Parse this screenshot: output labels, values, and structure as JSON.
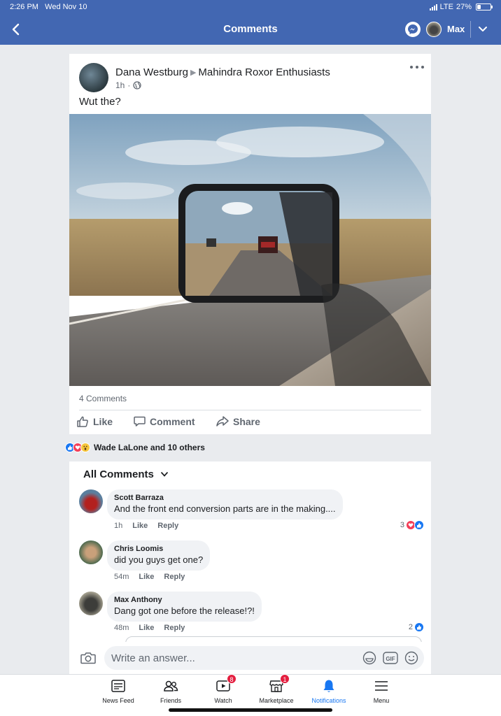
{
  "status_bar": {
    "time": "2:26 PM",
    "date": "Wed Nov 10",
    "network": "LTE",
    "battery": "27%",
    "battery_level": 0.27
  },
  "header": {
    "title": "Comments",
    "user_name": "Max",
    "messenger_icon": "messenger-icon",
    "back_icon": "chevron-left-icon",
    "menu_icon": "chevron-down-icon"
  },
  "post": {
    "author": "Dana Westburg",
    "group": "Mahindra Roxor Enthusiasts",
    "time": "1h",
    "privacy_icon": "globe-icon",
    "text": "Wut the?",
    "comment_count": "4 Comments",
    "actions": {
      "like": "Like",
      "comment": "Comment",
      "share": "Share"
    }
  },
  "reactions": {
    "summary": "Wade LaLone and 10 others",
    "types": [
      "like",
      "love",
      "wow"
    ]
  },
  "comments_section": {
    "filter_label": "All Comments",
    "comments": [
      {
        "name": "Scott Barraza",
        "text": "And the front end conversion parts are in the making....",
        "time": "1h",
        "like": "Like",
        "reply": "Reply",
        "reaction_count": "3",
        "reaction_types": [
          "love",
          "like"
        ]
      },
      {
        "name": "Chris Loomis",
        "text": "did you guys get one?",
        "time": "54m",
        "like": "Like",
        "reply": "Reply"
      },
      {
        "name": "Max Anthony",
        "text": "Dang got one before the release!?!",
        "time": "48m",
        "like": "Like",
        "reply": "Reply",
        "reaction_count": "2",
        "reaction_types": [
          "like"
        ]
      }
    ]
  },
  "composer": {
    "placeholder": "Write an answer...",
    "gif_label": "GIF"
  },
  "tabs": [
    {
      "label": "News Feed",
      "icon": "news-feed-icon"
    },
    {
      "label": "Friends",
      "icon": "friends-icon"
    },
    {
      "label": "Watch",
      "icon": "watch-icon",
      "badge": "8"
    },
    {
      "label": "Marketplace",
      "icon": "marketplace-icon",
      "badge": "1"
    },
    {
      "label": "Notifications",
      "icon": "bell-icon",
      "active": true
    },
    {
      "label": "Menu",
      "icon": "hamburger-icon"
    }
  ],
  "colors": {
    "brand": "#4267b2",
    "active_tab": "#1877f2",
    "badge": "#e41e3f",
    "like": "#1877f2",
    "love": "#f33e58"
  }
}
